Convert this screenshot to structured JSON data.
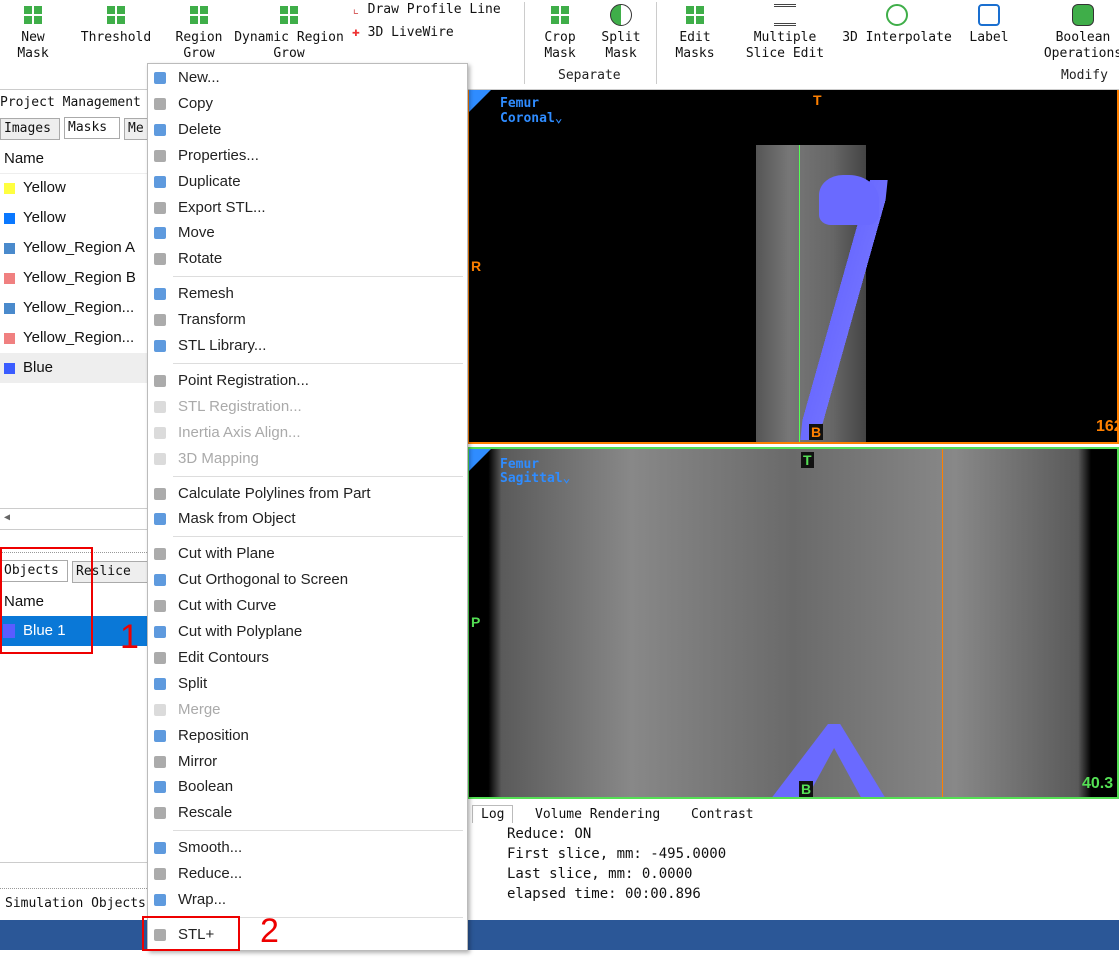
{
  "toolbar": {
    "buttons": [
      {
        "label": "New\nMask",
        "icon": "new-mask-icon"
      },
      {
        "label": "Threshold",
        "icon": "threshold-icon"
      },
      {
        "label": "Region\nGrow",
        "icon": "region-grow-icon"
      },
      {
        "label": "Dynamic Region\nGrow",
        "icon": "dynamic-region-grow-icon"
      },
      {
        "label": "Draw Profile Line",
        "icon": "profile-line-icon"
      },
      {
        "label": "3D LiveWire",
        "icon": "livewire-icon"
      },
      {
        "label": "Crop\nMask",
        "icon": "crop-mask-icon"
      },
      {
        "label": "Split\nMask",
        "icon": "split-mask-icon"
      },
      {
        "label": "Edit\nMasks",
        "icon": "edit-masks-icon"
      },
      {
        "label": "Multiple\nSlice Edit",
        "icon": "multiple-slice-edit-icon"
      },
      {
        "label": "3D Interpolate",
        "icon": "interpolate-icon"
      },
      {
        "label": "Label",
        "icon": "label-icon"
      },
      {
        "label": "Boolean\nOperations",
        "icon": "boolean-icon"
      }
    ],
    "groups": {
      "separate": "Separate",
      "modify": "Modify"
    }
  },
  "left": {
    "title": "Project Management",
    "tabs": [
      "Images",
      "Masks",
      "Me"
    ],
    "column": "Name",
    "masks": [
      {
        "name": "Yellow",
        "color": "#ffff40"
      },
      {
        "name": "Yellow",
        "color": "#0a78ff"
      },
      {
        "name": "Yellow_Region A",
        "color": "#4a8acc"
      },
      {
        "name": "Yellow_Region B",
        "color": "#f08080"
      },
      {
        "name": "Yellow_Region...",
        "color": "#4a8acc"
      },
      {
        "name": "Yellow_Region...",
        "color": "#f08080"
      },
      {
        "name": "Blue",
        "color": "#3a5cff"
      }
    ],
    "objects_tabs": [
      "Objects",
      "Reslice"
    ],
    "objects_column": "Name",
    "objects": [
      {
        "name": "Blue 1",
        "color": "#5a5cff",
        "selected": true
      }
    ],
    "simulation": "Simulation Objects"
  },
  "menu": {
    "items": [
      {
        "label": "New...",
        "icon": "plus-icon"
      },
      {
        "label": "Copy",
        "icon": "copy-icon"
      },
      {
        "label": "Delete",
        "icon": "x-icon"
      },
      {
        "label": "Properties...",
        "icon": "info-icon"
      },
      {
        "label": "Duplicate",
        "icon": "duplicate-icon"
      },
      {
        "label": "Export STL...",
        "icon": "export-icon"
      },
      {
        "label": "Move",
        "icon": "move-icon"
      },
      {
        "label": "Rotate",
        "icon": "rotate-icon",
        "sep": true
      },
      {
        "label": "Remesh",
        "icon": "remesh-icon"
      },
      {
        "label": "Transform",
        "icon": "transform-icon"
      },
      {
        "label": "STL Library...",
        "icon": "library-icon",
        "sep": true
      },
      {
        "label": "Point Registration...",
        "icon": "point-registration-icon"
      },
      {
        "label": "STL Registration...",
        "icon": "stl-registration-icon",
        "disabled": true
      },
      {
        "label": "Inertia Axis Align...",
        "icon": "inertia-icon",
        "disabled": true
      },
      {
        "label": "3D Mapping",
        "icon": "mapping-icon",
        "disabled": true,
        "sep": true
      },
      {
        "label": "Calculate Polylines from Part",
        "icon": "polylines-icon"
      },
      {
        "label": "Mask from Object",
        "icon": "mask-from-object-icon",
        "sep": true
      },
      {
        "label": "Cut with Plane",
        "icon": "cut-plane-icon"
      },
      {
        "label": "Cut Orthogonal to Screen",
        "icon": "cut-orthogonal-icon"
      },
      {
        "label": "Cut with Curve",
        "icon": "cut-curve-icon"
      },
      {
        "label": "Cut with Polyplane",
        "icon": "cut-polyplane-icon"
      },
      {
        "label": "Edit Contours",
        "icon": "edit-contours-icon"
      },
      {
        "label": "Split",
        "icon": "split-icon"
      },
      {
        "label": "Merge",
        "icon": "merge-icon",
        "disabled": true
      },
      {
        "label": "Reposition",
        "icon": "reposition-icon"
      },
      {
        "label": "Mirror",
        "icon": "mirror-icon"
      },
      {
        "label": "Boolean",
        "icon": "boolean-icon"
      },
      {
        "label": "Rescale",
        "icon": "rescale-icon",
        "sep": true
      },
      {
        "label": "Smooth...",
        "icon": "smooth-icon"
      },
      {
        "label": "Reduce...",
        "icon": "reduce-icon"
      },
      {
        "label": "Wrap...",
        "icon": "wrap-icon",
        "sep": true
      },
      {
        "label": "STL+",
        "icon": "stl-plus-icon"
      }
    ]
  },
  "views": {
    "coronal": {
      "name": "Femur",
      "orientation": "Coronal",
      "top": "T",
      "left": "R",
      "bottom": "B",
      "value": "162"
    },
    "sagittal": {
      "name": "Femur",
      "orientation": "Sagittal",
      "top": "T",
      "left": "P",
      "bottom": "B",
      "value": "40.3"
    }
  },
  "log": {
    "tabs": [
      "Log",
      "Volume Rendering",
      "Contrast"
    ],
    "lines": [
      "Reduce: ON",
      "First slice, mm: -495.0000",
      "Last slice, mm: 0.0000",
      "elapsed time: 00:00.896"
    ]
  },
  "annotations": {
    "one": "1",
    "two": "2"
  },
  "colors": {
    "accent": "#0a78d7",
    "selection": "#0a78d7",
    "coronal": "#ff8000",
    "sagittal": "#55e055",
    "mask": "#6a6aff"
  }
}
